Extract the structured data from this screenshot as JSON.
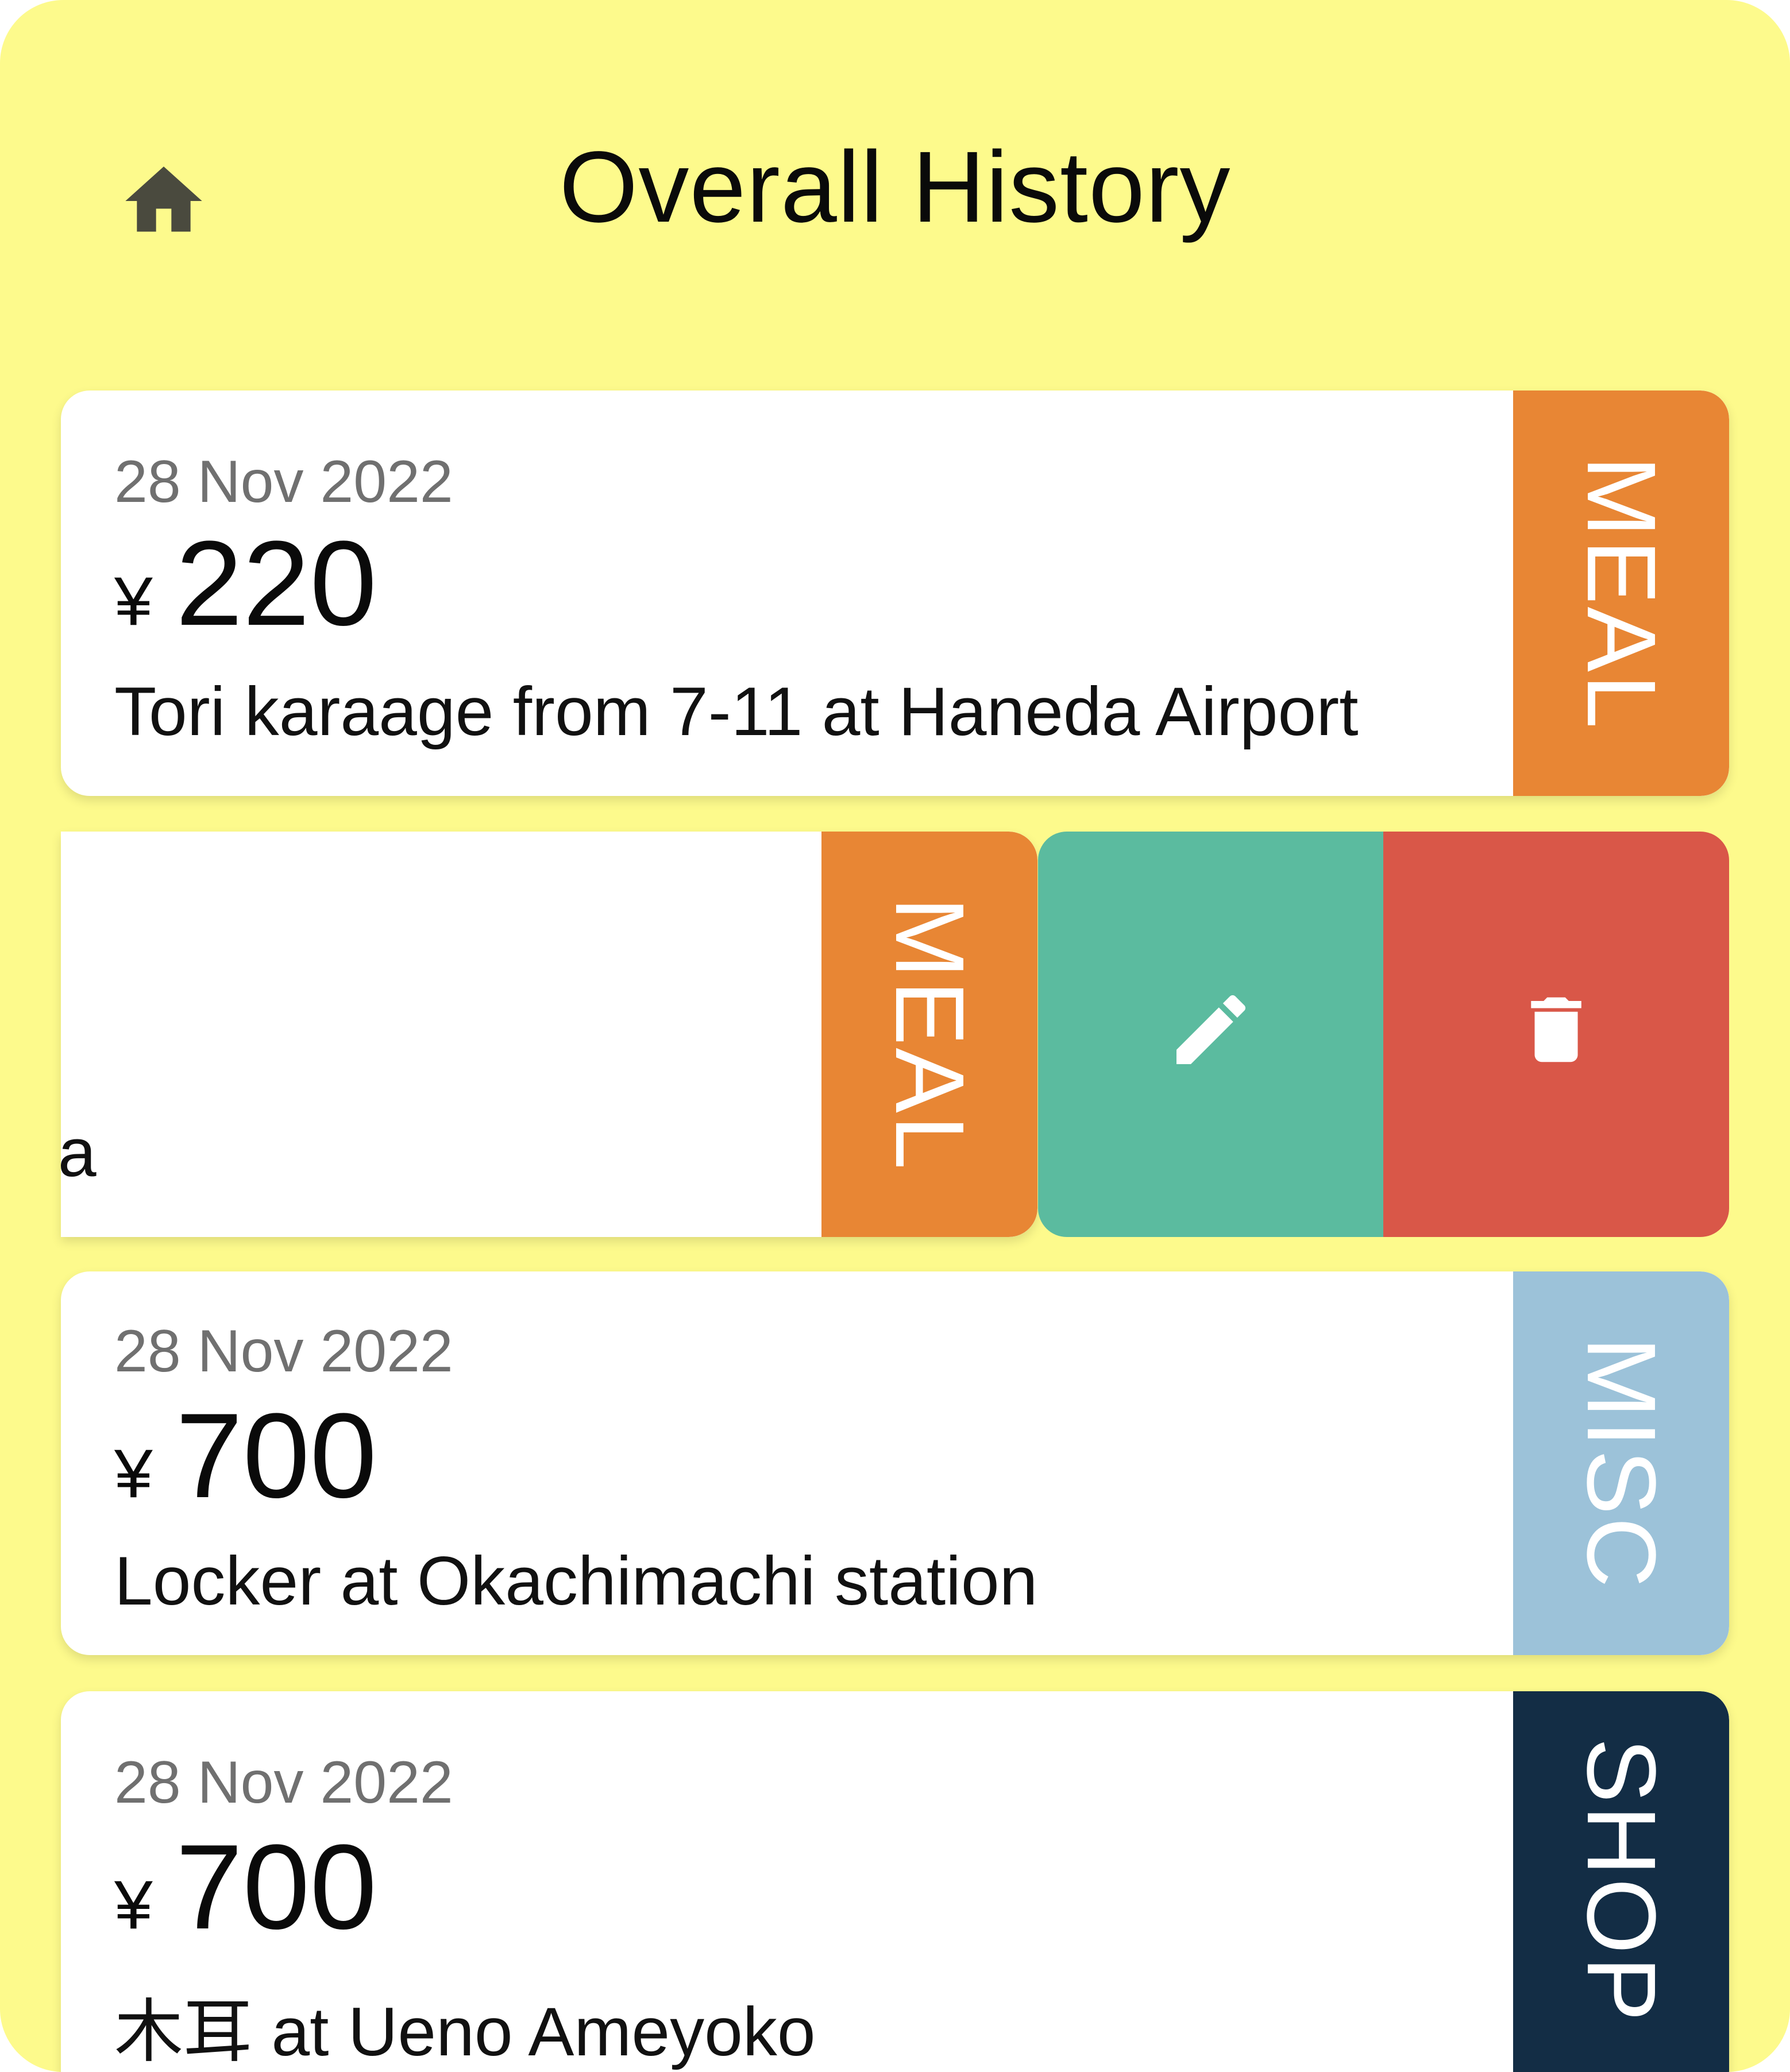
{
  "header": {
    "title": "Overall History",
    "home_icon": "home-icon"
  },
  "entries": [
    {
      "date": "28 Nov 2022",
      "currency": "¥",
      "amount": "220",
      "description": "Tori karaage from 7-11 at Haneda Airport",
      "category": "MEAL",
      "category_color": "#e88634"
    },
    {
      "description_fragment": "'a",
      "category": "MEAL",
      "category_color": "#e88634",
      "swiped": true
    },
    {
      "date": "28 Nov 2022",
      "currency": "¥",
      "amount": "700",
      "description": "Locker at Okachimachi station",
      "category": "MISC",
      "category_color": "#9cc2d9"
    },
    {
      "date": "28 Nov 2022",
      "currency": "¥",
      "amount": "700",
      "description": "木耳 at Ueno Ameyoko",
      "category": "SHOP",
      "category_color": "#132d45"
    }
  ],
  "swipe_actions": {
    "edit_icon": "pencil-icon",
    "edit_color": "#5bbb9f",
    "delete_icon": "trash-icon",
    "delete_color": "#d95748"
  },
  "colors": {
    "background": "#fdfa8c",
    "card": "#ffffff"
  }
}
